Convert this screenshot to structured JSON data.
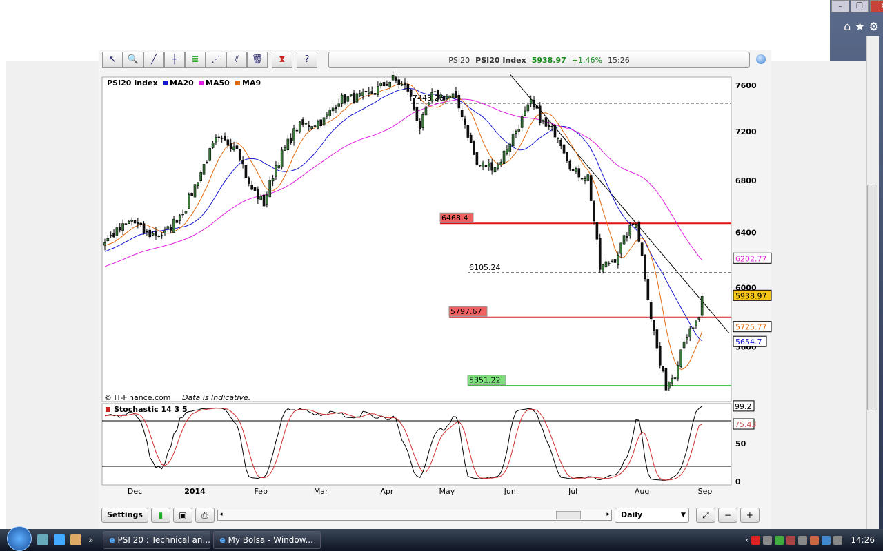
{
  "window_controls": [
    "minimize",
    "restore",
    "close"
  ],
  "ie_toolbar_icons": [
    "home-icon",
    "favorites-icon",
    "tools-icon"
  ],
  "toolbar": {
    "tools": [
      "pointer-icon",
      "zoom-in-icon",
      "trendline-icon",
      "horizontal-line-icon",
      "fibonacci-icon",
      "channel-icon",
      "parallel-lines-icon",
      "delete-icon",
      "indicator-icon",
      "help-icon"
    ]
  },
  "ticker": {
    "symbol": "PSI20",
    "name": "PSI20 Index",
    "price": "5938.97",
    "change": "+1.46%",
    "time": "15:26"
  },
  "chart_data": {
    "type": "candlestick",
    "title": "PSI20 Index",
    "legend": [
      {
        "name": "MA20",
        "color": "#1515d0"
      },
      {
        "name": "MA50",
        "color": "#e020e0"
      },
      {
        "name": "MA9",
        "color": "#e06a10"
      }
    ],
    "legend_placement": "top-left",
    "scale": "log",
    "ylim": [
      5240,
      7700
    ],
    "y_ticks": [
      7600,
      7200,
      6800,
      6400,
      6000,
      5600
    ],
    "x_ticks": [
      "Dec",
      "2014",
      "Feb",
      "Mar",
      "Apr",
      "May",
      "Jun",
      "Jul",
      "Aug",
      "Sep"
    ],
    "x_tick_days": [
      10,
      30,
      52,
      72,
      94,
      114,
      135,
      156,
      179,
      200
    ],
    "trading_days": 200,
    "close_keypoints": [
      [
        0,
        6336
      ],
      [
        9,
        6490
      ],
      [
        14,
        6386
      ],
      [
        20,
        6386
      ],
      [
        27,
        6595
      ],
      [
        34,
        6978
      ],
      [
        37,
        7120
      ],
      [
        44,
        7092
      ],
      [
        48,
        6757
      ],
      [
        53,
        6622
      ],
      [
        57,
        6922
      ],
      [
        64,
        7236
      ],
      [
        73,
        7295
      ],
      [
        78,
        7473
      ],
      [
        87,
        7503
      ],
      [
        96,
        7655
      ],
      [
        101,
        7563
      ],
      [
        105,
        7236
      ],
      [
        109,
        7503
      ],
      [
        116,
        7503
      ],
      [
        119,
        7353
      ],
      [
        124,
        6922
      ],
      [
        131,
        6922
      ],
      [
        135,
        7120
      ],
      [
        142,
        7440
      ],
      [
        147,
        7236
      ],
      [
        151,
        7180
      ],
      [
        156,
        6867
      ],
      [
        161,
        6833
      ],
      [
        163,
        6490
      ],
      [
        165,
        6134
      ],
      [
        170,
        6210
      ],
      [
        174,
        6386
      ],
      [
        177,
        6490
      ],
      [
        180,
        6086
      ],
      [
        182,
        5801
      ],
      [
        185,
        5481
      ],
      [
        187,
        5350
      ],
      [
        190,
        5436
      ],
      [
        193,
        5660
      ],
      [
        196,
        5706
      ],
      [
        198,
        5801
      ],
      [
        199,
        5938.97
      ]
    ],
    "last_values": {
      "close": "5938.97",
      "MA50": "6202.77",
      "MA9": "5725.77",
      "MA20": "5654.7"
    },
    "horizontal_lines": [
      {
        "value": 7443.26,
        "label": "7443.26",
        "style": "dashed",
        "color": "#000000"
      },
      {
        "value": 6468.4,
        "label": "6468.4",
        "style": "solid",
        "color": "#e01010"
      },
      {
        "value": 6105.24,
        "label": "6105.24",
        "style": "dashed",
        "color": "#000000"
      },
      {
        "value": 5797.67,
        "label": "5797.67",
        "style": "solid",
        "color": "#d02020"
      },
      {
        "value": 5351.22,
        "label": "5351.22",
        "style": "solid",
        "color": "#10b010"
      }
    ],
    "trendline": {
      "from": [
        135,
        7700
      ],
      "to": [
        208,
        5690
      ]
    },
    "credit": "© IT-Finance.com",
    "note": "Data is Indicative.",
    "indicator": {
      "title": "Stochastic 14 3 5",
      "ylim": [
        0,
        100
      ],
      "y_ticks": [
        0,
        50
      ],
      "levels": [
        20,
        80
      ],
      "last_k": "99.2",
      "last_d": "75.43"
    }
  },
  "bottom": {
    "settings": "Settings",
    "period": "Daily"
  },
  "taskbar": {
    "tasks": [
      "PSI 20 : Technical an...",
      "My Bolsa - Window..."
    ],
    "clock": "14:26"
  }
}
